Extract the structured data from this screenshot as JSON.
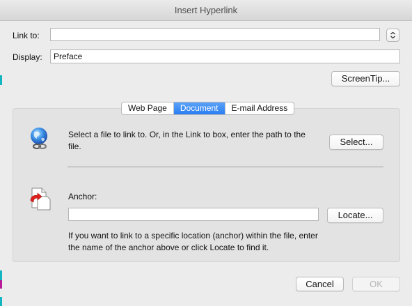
{
  "window": {
    "title": "Insert Hyperlink"
  },
  "link_to": {
    "label": "Link to:",
    "value": ""
  },
  "display": {
    "label": "Display:",
    "value": "Preface"
  },
  "screentip_label": "ScreenTip...",
  "tabs": [
    {
      "label": "Web Page",
      "active": false
    },
    {
      "label": "Document",
      "active": true
    },
    {
      "label": "E-mail Address",
      "active": false
    }
  ],
  "document": {
    "select_text": "Select a file to link to. Or, in the Link to box, enter the path to the file.",
    "select_label": "Select...",
    "anchor_label": "Anchor:",
    "anchor_value": "",
    "locate_label": "Locate...",
    "anchor_help": "If you want to link to a specific location (anchor) within the file, enter the name of the anchor above or click Locate to find it."
  },
  "cancel_label": "Cancel",
  "ok_label": "OK",
  "colors": {
    "accent": "#2a7ef3",
    "background": "#ececec"
  }
}
